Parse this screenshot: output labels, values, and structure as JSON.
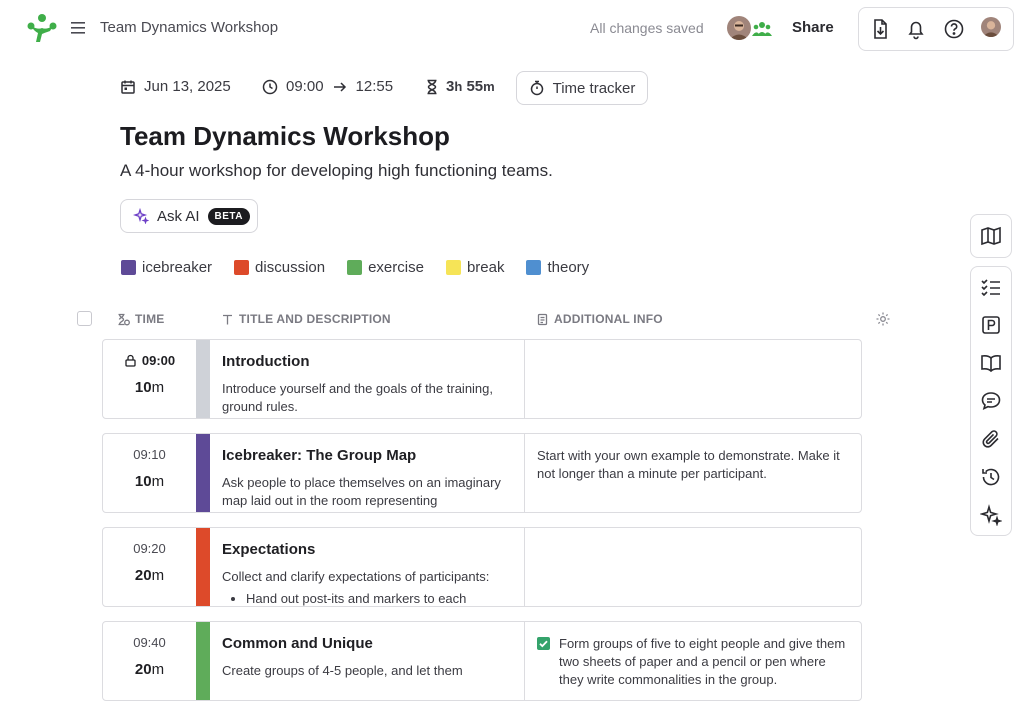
{
  "app": {
    "doc_title": "Team Dynamics Workshop",
    "save_status": "All changes saved",
    "share_label": "Share"
  },
  "meta": {
    "date": "Jun 13, 2025",
    "start_time": "09:00",
    "end_time": "12:55",
    "duration_hours": "3",
    "duration_hours_unit": "h",
    "duration_minutes": "55",
    "duration_minutes_unit": "m",
    "time_tracker_label": "Time tracker"
  },
  "page": {
    "title": "Team Dynamics Workshop",
    "subtitle": "A 4-hour workshop for developing high functioning teams.",
    "ask_ai_label": "Ask AI",
    "beta_badge": "BETA"
  },
  "legend": [
    {
      "label": "icebreaker",
      "color": "#5e4a97"
    },
    {
      "label": "discussion",
      "color": "#dd4a2a"
    },
    {
      "label": "exercise",
      "color": "#5fac5a"
    },
    {
      "label": "break",
      "color": "#f6e457"
    },
    {
      "label": "theory",
      "color": "#4f8fd0"
    }
  ],
  "table": {
    "col_time": "TIME",
    "col_title": "TITLE AND DESCRIPTION",
    "col_info": "ADDITIONAL INFO"
  },
  "rows": [
    {
      "start": "09:00",
      "duration": "10",
      "unit": "m",
      "color": "#cfd2d8",
      "title": "Introduction",
      "description": "Introduce yourself and the goals of the training, ground rules.",
      "bullet": "",
      "info": ""
    },
    {
      "start": "09:10",
      "duration": "10",
      "unit": "m",
      "color": "#5e4a97",
      "title": "Icebreaker: The Group Map",
      "description": "Ask people to place themselves on an imaginary map laid out in the room representing",
      "bullet": "",
      "info": "Start with your own example to demonstrate. Make it not longer than a minute per participant."
    },
    {
      "start": "09:20",
      "duration": "20",
      "unit": "m",
      "color": "#dd4a2a",
      "title": "Expectations",
      "description": "Collect and clarify expectations of participants:",
      "bullet": "Hand out post-its and markers to each",
      "info": ""
    },
    {
      "start": "09:40",
      "duration": "20",
      "unit": "m",
      "color": "#5fac5a",
      "title": "Common and Unique",
      "description": "Create groups of 4-5 people, and let them",
      "bullet": "",
      "info": "Form groups of five to eight people and give them two sheets of paper and a pencil or pen where they write commonalities in the group."
    }
  ]
}
